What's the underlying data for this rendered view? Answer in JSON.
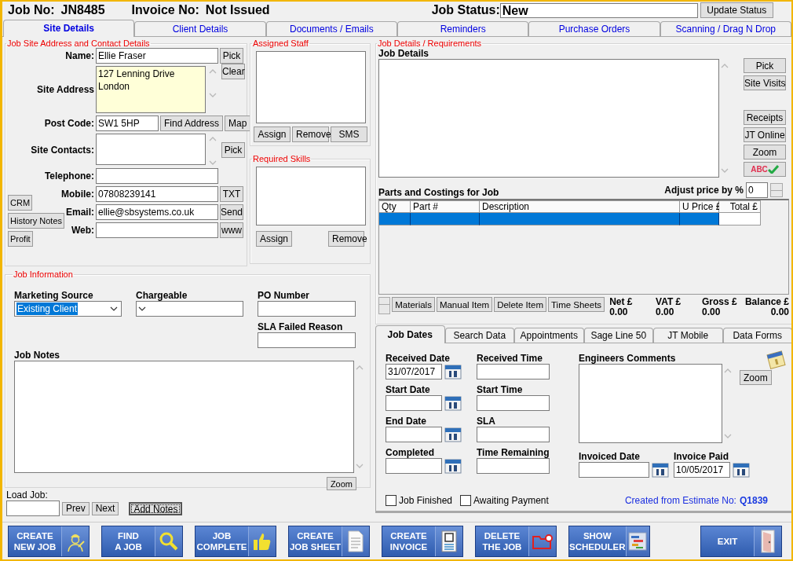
{
  "header": {
    "job_no_label": "Job No:",
    "job_no": "JN8485",
    "invoice_label": "Invoice No:",
    "invoice_no": "Not Issued",
    "status_label": "Job Status:",
    "status": "New",
    "update_button": "Update Status"
  },
  "tabs": [
    {
      "label": "Site Details",
      "selected": true
    },
    {
      "label": "Client Details",
      "selected": false
    },
    {
      "label": "Documents / Emails",
      "selected": false
    },
    {
      "label": "Reminders",
      "selected": false
    },
    {
      "label": "Purchase Orders",
      "selected": false
    },
    {
      "label": "Scanning / Drag N Drop",
      "selected": false
    }
  ],
  "contact": {
    "title": "Job Site Address and Contact Details",
    "name": {
      "label": "Name:",
      "value": "Ellie Fraser",
      "button": "Pick"
    },
    "address": {
      "label": "Site Address",
      "value": "127 Lenning Drive\nLondon",
      "button": "Clear"
    },
    "post_code": {
      "label": "Post Code:",
      "value": "SW1 5HP",
      "buttons": [
        "Find Address",
        "Map"
      ]
    },
    "site_contacts": {
      "label": "Site Contacts:",
      "button": "Pick"
    },
    "telephone": {
      "label": "Telephone:"
    },
    "mobile": {
      "label": "Mobile:",
      "value": "07808239141",
      "button": "TXT"
    },
    "email": {
      "label": "Email:",
      "value": "ellie@sbsystems.co.uk",
      "button": "Send"
    },
    "web": {
      "label": "Web:",
      "button": "www"
    },
    "side_buttons": [
      "CRM",
      "History Notes",
      "Profit"
    ]
  },
  "assigned_staff": {
    "title": "Assigned Staff",
    "buttons": [
      "Assign",
      "Remove",
      "SMS"
    ]
  },
  "required_skills": {
    "title": "Required Skills",
    "buttons": [
      "Assign",
      "Remove"
    ]
  },
  "job_info": {
    "title": "Job Information",
    "marketing_source": {
      "label": "Marketing Source",
      "value": "Existing Client",
      "highlighted": true
    },
    "chargeable": {
      "label": "Chargeable"
    },
    "po_number": {
      "label": "PO Number"
    },
    "sla_failed_reason": {
      "label": "SLA Failed Reason"
    },
    "job_notes": {
      "label": "Job Notes"
    },
    "zoom_button": "Zoom"
  },
  "load_job": {
    "label": "Load Job:",
    "buttons": [
      {
        "label": "Prev",
        "focused": false
      },
      {
        "label": "Next",
        "focused": false
      },
      {
        "label": "Add Notes",
        "focused": true
      }
    ]
  },
  "job_details": {
    "title": "Job Details / Requirements",
    "label": "Job Details",
    "buttons_top": [
      "Pick",
      "Site Visits"
    ],
    "buttons_bottom": [
      "Receipts",
      "JT Online",
      "Zoom"
    ],
    "spell_button": "ABC",
    "parts_label": "Parts and Costings for Job",
    "adjust_label": "Adjust price by %",
    "adjust_value": "0",
    "table": {
      "columns": [
        "Qty",
        "Part #",
        "Description",
        "U Price £",
        "Total £"
      ],
      "rows": [
        {
          "selected": true
        }
      ]
    },
    "item_buttons": [
      "Materials",
      "Manual Item",
      "Delete Item",
      "Time Sheets"
    ],
    "totals": [
      {
        "label": "Net £",
        "value": "0.00"
      },
      {
        "label": "VAT £",
        "value": "0.00"
      },
      {
        "label": "Gross £",
        "value": "0.00"
      },
      {
        "label": "Balance £",
        "value": "0.00"
      }
    ]
  },
  "lower_tabs": [
    {
      "label": "Job Dates",
      "selected": true
    },
    {
      "label": "Search Data",
      "selected": false
    },
    {
      "label": "Appointments",
      "selected": false
    },
    {
      "label": "Sage Line 50",
      "selected": false
    },
    {
      "label": "JT Mobile",
      "selected": false
    },
    {
      "label": "Data Forms",
      "selected": false
    }
  ],
  "job_dates": {
    "dates": [
      {
        "label": "Received Date",
        "value": "31/07/2017"
      },
      {
        "label": "Start Date"
      },
      {
        "label": "End Date"
      },
      {
        "label": "Completed"
      }
    ],
    "times": [
      {
        "label": "Received Time"
      },
      {
        "label": "Start Time"
      },
      {
        "label": "SLA"
      },
      {
        "label": "Time Remaining"
      }
    ],
    "comments_label": "Engineers Comments",
    "zoom_button": "Zoom",
    "invoiced_date": {
      "label": "Invoiced Date"
    },
    "invoice_paid": {
      "label": "Invoice Paid",
      "value": "10/05/2017"
    },
    "checkboxes": [
      {
        "label": "Job Finished",
        "checked": false
      },
      {
        "label": "Awaiting Payment",
        "checked": false
      }
    ],
    "estimate_label": "Created from Estimate  No:",
    "estimate_no": "Q1839"
  },
  "toolbar": [
    {
      "label": "CREATE\nNEW JOB",
      "kind": "worker"
    },
    {
      "label": "FIND\nA JOB",
      "kind": "search"
    },
    {
      "label": "JOB\nCOMPLETE",
      "kind": "thumb"
    },
    {
      "label": "CREATE\nJOB SHEET",
      "kind": "document"
    },
    {
      "label": "CREATE\nINVOICE",
      "kind": "invoice"
    },
    {
      "label": "DELETE\nTHE JOB",
      "kind": "folder"
    },
    {
      "label": "SHOW\nSCHEDULER",
      "kind": "scheduler"
    },
    {
      "label": "EXIT",
      "kind": "door"
    }
  ]
}
